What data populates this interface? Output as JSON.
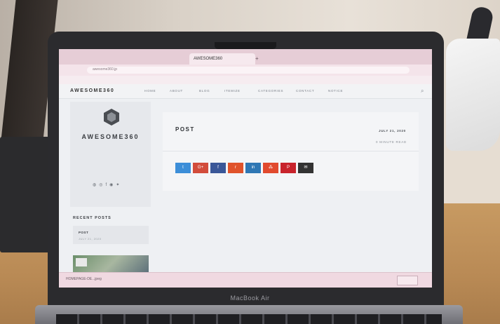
{
  "browser": {
    "tabs": [
      "",
      "",
      "AWESOME360"
    ],
    "url": "awesome360.jp",
    "bookmarks": [
      "",
      "",
      ""
    ],
    "bookmark_right": ""
  },
  "site": {
    "logo": "AWESOME360",
    "nav": [
      "HOME",
      "ABOUT",
      "BLOG",
      "ITEMIZE",
      "CATEGORIES",
      "CONTACT",
      "NOTICE"
    ],
    "title": "AWESOME360",
    "description": "",
    "social_icons": [
      "github-icon",
      "instagram-icon",
      "facebook-icon",
      "instagram-icon",
      "twitter-icon"
    ]
  },
  "post": {
    "title": "POST",
    "date": "JULY 21, 2020",
    "read_time": "0 MINUTE READ"
  },
  "share_buttons": [
    {
      "glyph": "t",
      "name": "twitter",
      "color": "#3c8ed8"
    },
    {
      "glyph": "G+",
      "name": "google-plus",
      "color": "#d24c3b"
    },
    {
      "glyph": "f",
      "name": "facebook",
      "color": "#3a5798"
    },
    {
      "glyph": "r",
      "name": "reddit",
      "color": "#e0532b"
    },
    {
      "glyph": "in",
      "name": "linkedin",
      "color": "#2f77b4"
    },
    {
      "glyph": "⁂",
      "name": "stumbleupon",
      "color": "#e14a2e"
    },
    {
      "glyph": "P",
      "name": "pinterest",
      "color": "#c8232c"
    },
    {
      "glyph": "✉",
      "name": "email",
      "color": "#333333"
    }
  ],
  "recent": {
    "heading": "RECENT POSTS",
    "items": [
      {
        "title": "POST",
        "date": "JULY 21, 2020"
      }
    ]
  },
  "downloads": {
    "item": "HOMEPAGE-DE...jpeg",
    "show_all": ""
  },
  "device": {
    "brand": "MacBook Air"
  }
}
